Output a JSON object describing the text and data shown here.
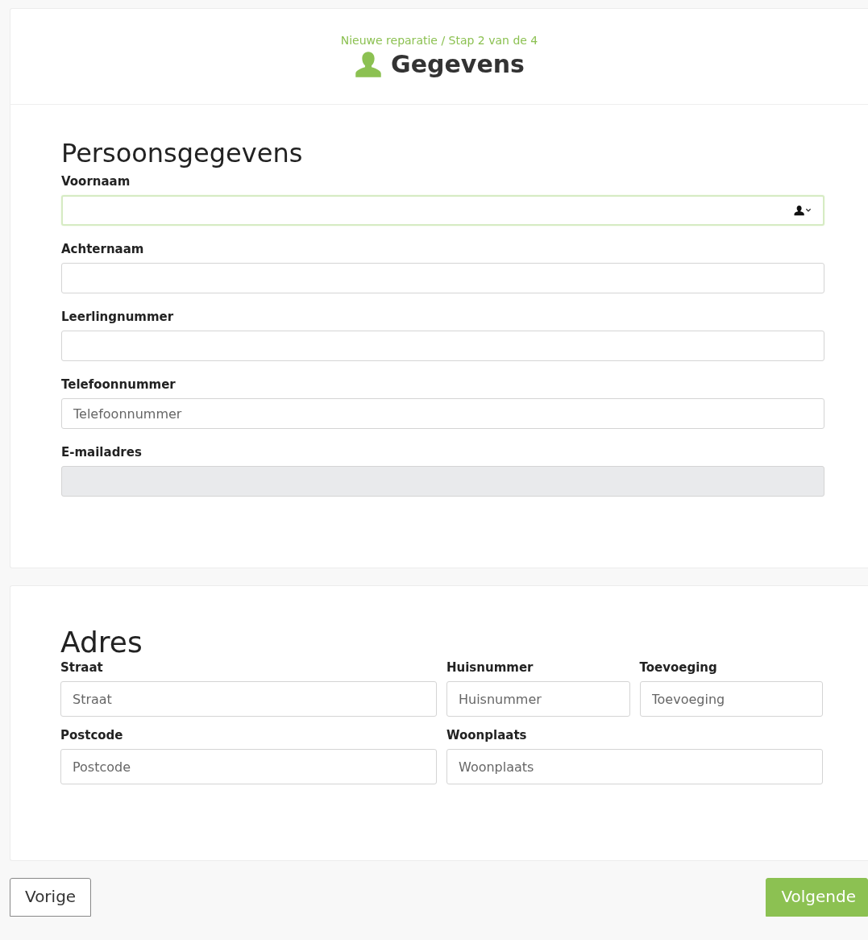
{
  "header": {
    "breadcrumb": "Nieuwe reparatie / Stap 2 van de 4",
    "title": "Gegevens"
  },
  "sections": [
    {
      "title": "Persoonsgegevens",
      "rows": [
        [
          {
            "label": "Voornaam",
            "kind": "contact",
            "focused": true,
            "disabled": false
          }
        ],
        [
          {
            "label": "Achternaam",
            "kind": "text",
            "focused": false,
            "disabled": false
          }
        ],
        [
          {
            "label": "Leerlingnummer",
            "kind": "text",
            "focused": false,
            "disabled": false
          }
        ],
        [
          {
            "label": "Telefoonnummer",
            "placeholder": "Telefoonnummer",
            "kind": "text",
            "focused": false,
            "disabled": false
          }
        ],
        [
          {
            "label": "E-mailadres",
            "kind": "text",
            "focused": false,
            "disabled": true
          }
        ]
      ]
    },
    {
      "title": "Adres",
      "rows": [
        [
          {
            "label": "Straat",
            "placeholder": "Straat",
            "kind": "text",
            "focused": false,
            "disabled": false
          },
          {
            "label": "Huisnummer",
            "placeholder": "Huisnummer",
            "kind": "text",
            "focused": false,
            "disabled": false
          },
          {
            "label": "Toevoeging",
            "placeholder": "Toevoeging",
            "kind": "text",
            "focused": false,
            "disabled": false
          }
        ],
        [
          {
            "label": "Postcode",
            "placeholder": "Postcode",
            "kind": "text",
            "focused": false,
            "disabled": false
          },
          {
            "label": "Woonplaats",
            "placeholder": "Woonplaats",
            "kind": "text",
            "focused": false,
            "disabled": false
          }
        ]
      ]
    }
  ],
  "buttons": [
    {
      "label": "Vorige",
      "kind": "secondary"
    },
    {
      "label": "Volgende",
      "kind": "primary"
    }
  ]
}
